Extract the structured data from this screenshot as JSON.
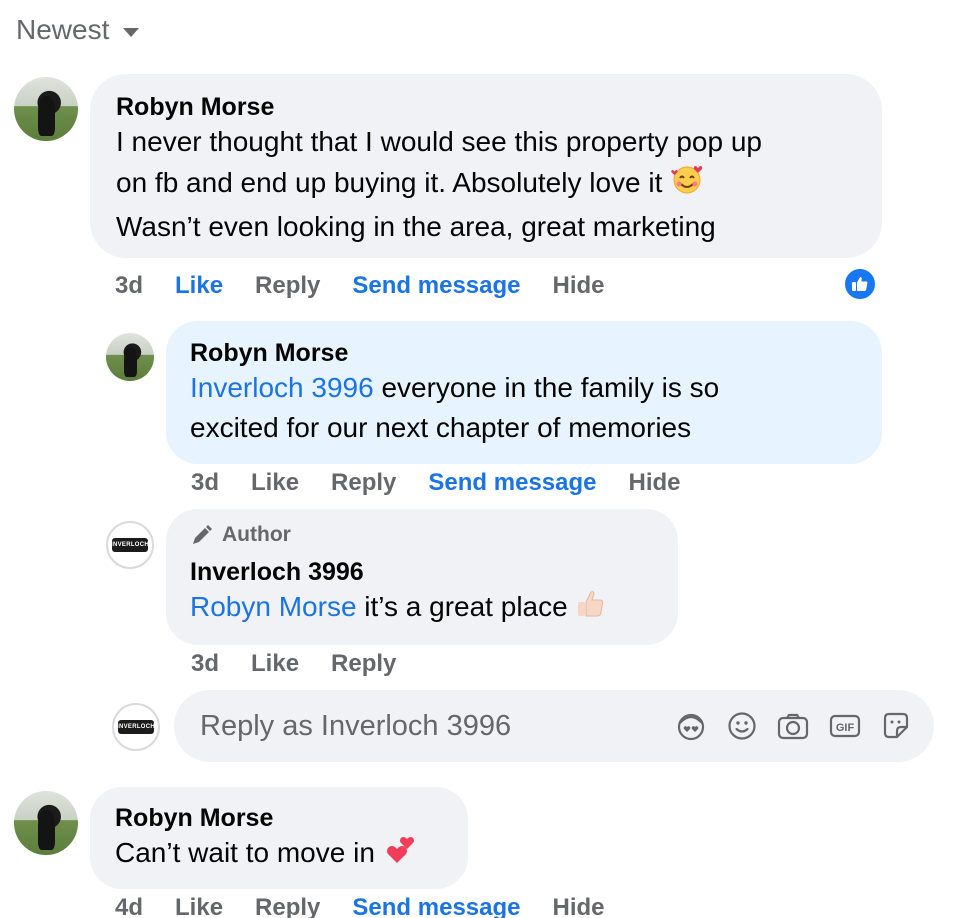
{
  "sort": {
    "label": "Newest"
  },
  "comments": [
    {
      "author": "Robyn Morse",
      "lines": [
        "I never thought that I would see this property pop up",
        "on fb and end up buying it. Absolutely love it",
        "Wasn’t even looking in the area, great marketing"
      ],
      "emoji": "smiling-face-with-hearts",
      "time": "3d",
      "actions": [
        "Like",
        "Reply",
        "Send message",
        "Hide"
      ],
      "reaction": "like-reaction"
    },
    {
      "author": "Robyn Morse",
      "mention": "Inverloch 3996",
      "line1_rest": " everyone in the family is so",
      "line2": "excited for our next chapter of memories",
      "time": "3d",
      "actions": [
        "Like",
        "Reply",
        "Send message",
        "Hide"
      ]
    },
    {
      "badge": "Author",
      "author": "Inverloch 3996",
      "mention": "Robyn Morse",
      "text_rest": " it’s a great place",
      "emoji": "thumbs-up-light-skin",
      "time": "3d",
      "actions": [
        "Like",
        "Reply"
      ]
    },
    {
      "author": "Robyn Morse",
      "text": "Can’t wait to move in",
      "emoji": "two-hearts",
      "time": "4d",
      "actions": [
        "Like",
        "Reply",
        "Send message",
        "Hide"
      ]
    }
  ],
  "reply_box": {
    "placeholder": "Reply as Inverloch 3996",
    "tools": [
      "avatar-sticker-icon",
      "emoji-icon",
      "camera-icon",
      "gif-icon",
      "sticker-icon"
    ]
  },
  "brand": {
    "logo_text": "INVERLOCH"
  },
  "colors": {
    "link": "#1b74e4",
    "muted": "#65676b",
    "bubble": "#f0f2f5",
    "highlight": "#e7f3ff",
    "like": "#1877f2"
  }
}
